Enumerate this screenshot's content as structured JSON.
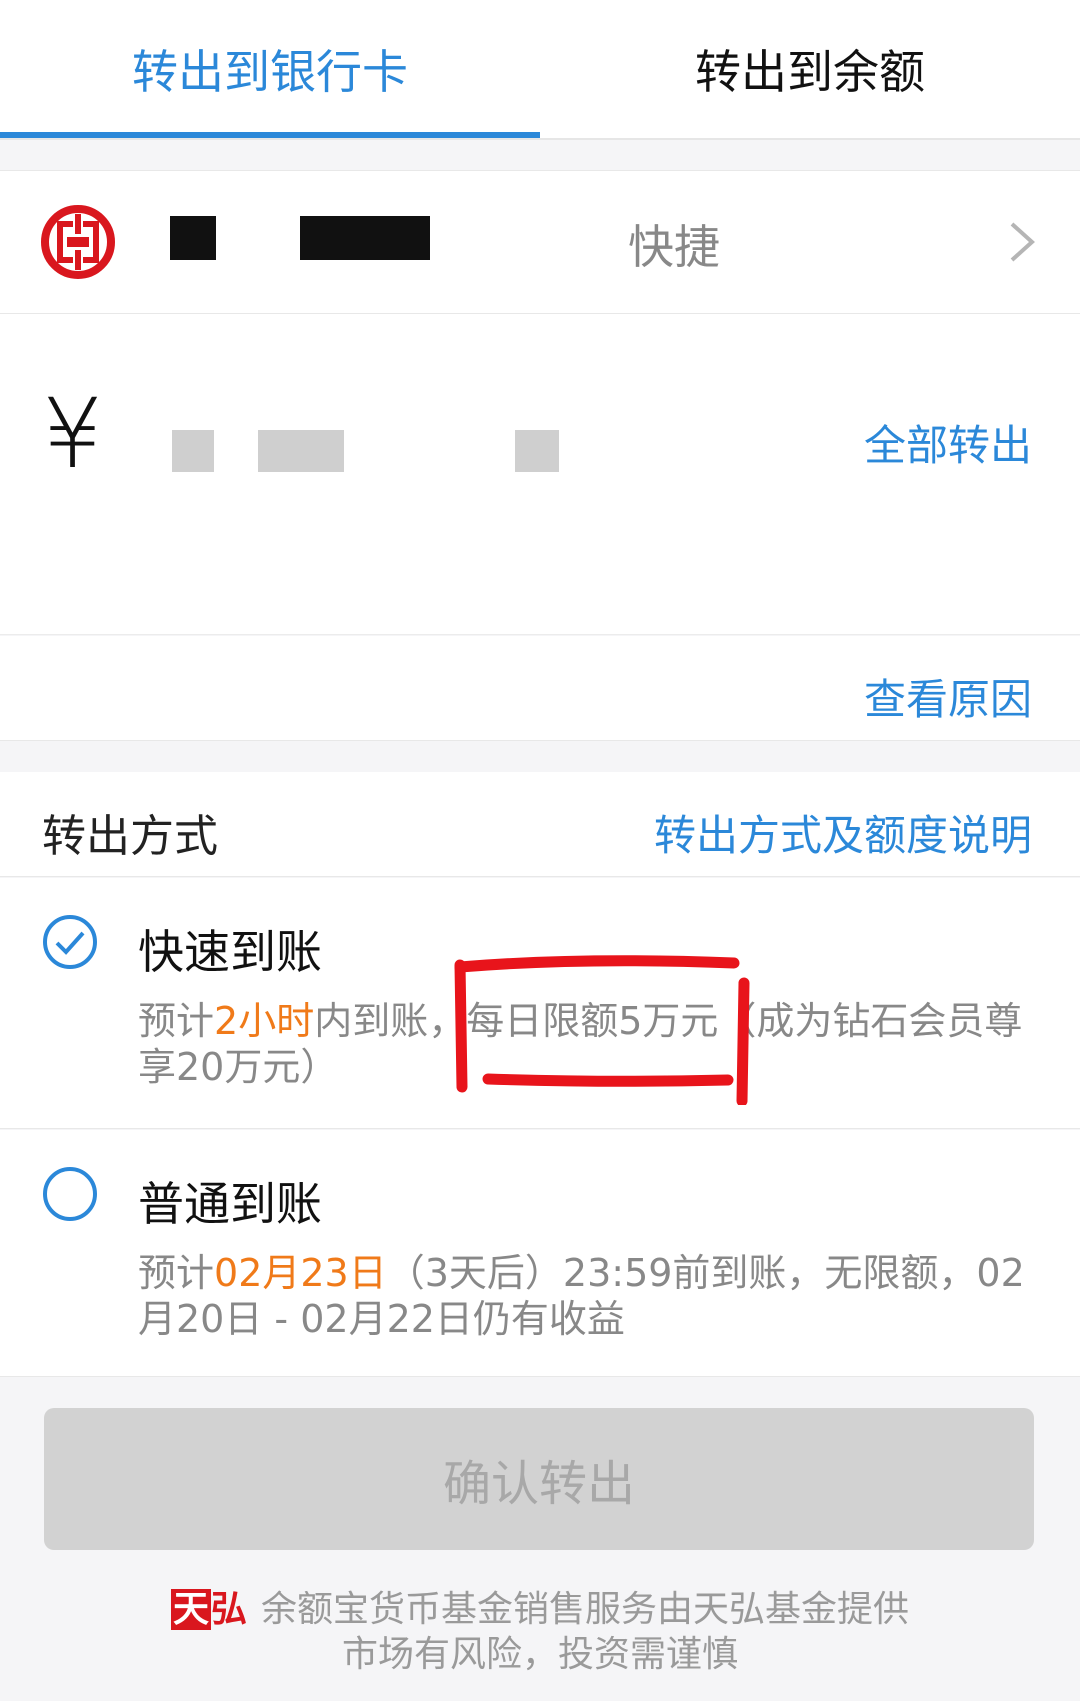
{
  "tabs": {
    "bank_card": "转出到银行卡",
    "balance": "转出到余额"
  },
  "bank": {
    "type": "快捷"
  },
  "amount": {
    "currency_symbol": "¥",
    "all_out": "全部转出",
    "view_reason": "查看原因"
  },
  "method": {
    "title": "转出方式",
    "note": "转出方式及额度说明",
    "fast": {
      "title": "快速到账",
      "desc_prefix": "预计",
      "desc_highlight": "2小时",
      "desc_rest": "内到账，每日限额5万元（成为钻石会员尊享20万元）"
    },
    "normal": {
      "title": "普通到账",
      "desc_prefix": "预计",
      "desc_highlight": "02月23日",
      "desc_rest": "（3天后）23:59前到账，无限额，02月20日 - 02月22日仍有收益"
    }
  },
  "confirm": {
    "label": "确认转出"
  },
  "footer": {
    "logo_left": "天",
    "logo_right": "弘",
    "line1": "余额宝货币基金销售服务由天弘基金提供",
    "line2": "市场有风险，投资需谨慎"
  },
  "colors": {
    "accent": "#2b88d9",
    "highlight": "#f07a19",
    "annotation": "#e8141b"
  }
}
